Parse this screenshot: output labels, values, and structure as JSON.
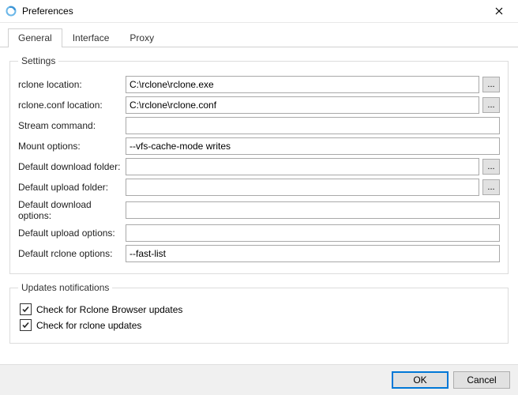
{
  "window": {
    "title": "Preferences"
  },
  "tabs": {
    "general": "General",
    "interface": "Interface",
    "proxy": "Proxy"
  },
  "settingsGroup": {
    "legend": "Settings",
    "rcloneLocationLabel": "rclone location:",
    "rcloneLocationValue": "C:\\rclone\\rclone.exe",
    "rcloneConfLabel": "rclone.conf location:",
    "rcloneConfValue": "C:\\rclone\\rclone.conf",
    "streamCmdLabel": "Stream command:",
    "streamCmdValue": "",
    "mountOptLabel": "Mount options:",
    "mountOptValue": "--vfs-cache-mode writes",
    "defDownloadFolderLabel": "Default download folder:",
    "defDownloadFolderValue": "",
    "defUploadFolderLabel": "Default upload folder:",
    "defUploadFolderValue": "",
    "defDownloadOptLabel": "Default download options:",
    "defDownloadOptValue": "",
    "defUploadOptLabel": "Default upload options:",
    "defUploadOptValue": "",
    "defRcloneOptLabel": "Default rclone options:",
    "defRcloneOptValue": "--fast-list",
    "browseGlyph": "..."
  },
  "updatesGroup": {
    "legend": "Updates notifications",
    "checkBrowser": "Check for Rclone Browser updates",
    "checkRclone": "Check for rclone updates"
  },
  "footer": {
    "ok": "OK",
    "cancel": "Cancel"
  }
}
